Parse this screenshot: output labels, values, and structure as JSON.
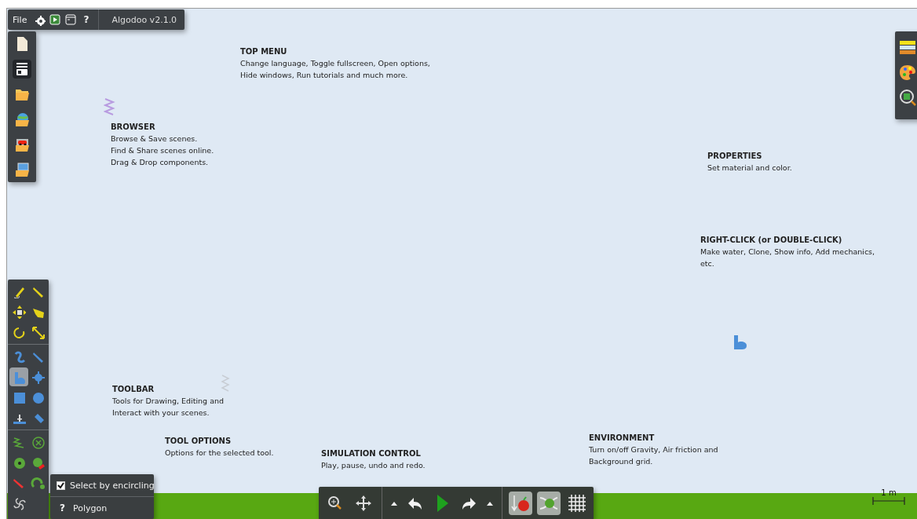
{
  "top_menu": {
    "file": "File",
    "help": "?",
    "version": "Algodoo v2.1.0"
  },
  "browser": {
    "items": [
      {
        "selected": false
      },
      {
        "selected": true
      },
      {
        "selected": false
      },
      {
        "selected": false
      },
      {
        "selected": false
      },
      {
        "selected": false
      }
    ]
  },
  "annotations": [
    {
      "title": "TOP MENU",
      "lines": [
        "Change language, Toggle fullscreen, Open options,",
        "Hide windows, Run tutorials and much more."
      ]
    },
    {
      "title": "BROWSER",
      "lines": [
        "Browse & Save scenes.",
        "Find & Share scenes online.",
        "Drag & Drop components."
      ]
    },
    {
      "title": "PROPERTIES",
      "lines": [
        "Set material and color."
      ]
    },
    {
      "title": "RIGHT-CLICK (or DOUBLE-CLICK)",
      "lines": [
        "Make water, Clone, Show info, Add mechanics,",
        "etc."
      ]
    },
    {
      "title": "TOOLBAR",
      "lines": [
        "Tools for Drawing, Editing and",
        "Interact with your scenes."
      ]
    },
    {
      "title": "TOOL OPTIONS",
      "lines": [
        "Options for the selected tool."
      ]
    },
    {
      "title": "SIMULATION CONTROL",
      "lines": [
        "Play, pause, undo and redo."
      ]
    },
    {
      "title": "ENVIRONMENT",
      "lines": [
        "Turn on/off Gravity, Air friction and",
        "Background grid."
      ]
    }
  ],
  "toolbar": {
    "sections": [
      [
        {
          "selected": false
        },
        {
          "selected": false
        },
        {
          "selected": false
        },
        {
          "selected": false
        },
        {
          "selected": false
        },
        {
          "selected": false
        }
      ],
      [
        {
          "selected": false
        },
        {
          "selected": false
        },
        {
          "selected": true
        },
        {
          "selected": false
        },
        {
          "selected": false
        },
        {
          "selected": false
        },
        {
          "selected": false
        },
        {
          "selected": false
        }
      ],
      [
        {
          "selected": false
        },
        {
          "selected": false
        },
        {
          "selected": false
        },
        {
          "selected": false
        },
        {
          "selected": false
        },
        {
          "selected": false
        },
        {
          "selected": false
        }
      ]
    ]
  },
  "tool_options": {
    "checkbox": {
      "label": "Select by encircling",
      "checked": true
    },
    "help": {
      "icon": "?",
      "label": "Polygon"
    }
  },
  "environment": [
    {
      "on": true
    },
    {
      "on": true
    },
    {
      "on": false
    }
  ],
  "scale": {
    "label": "1 m"
  }
}
